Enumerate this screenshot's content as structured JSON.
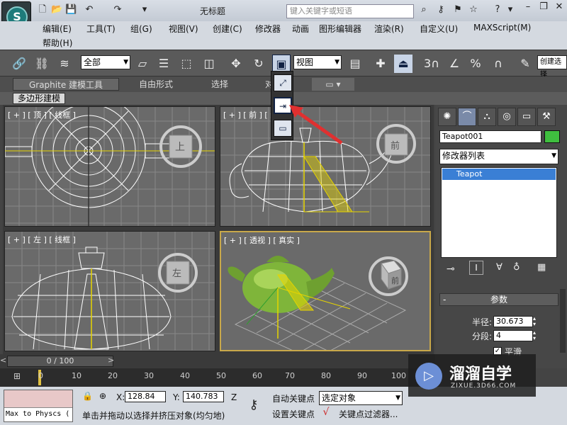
{
  "window": {
    "title": "无标题",
    "search_placeholder": "键入关键字或短语"
  },
  "menu": [
    "编辑(E)",
    "工具(T)",
    "组(G)",
    "视图(V)",
    "创建(C)",
    "修改器",
    "动画",
    "图形编辑器",
    "渲染(R)",
    "自定义(U)",
    "MAXScript(M)",
    "帮助(H)"
  ],
  "toolbar": {
    "selection_filter": "全部",
    "reference_coord": "视图",
    "named_selection": "创建选择"
  },
  "ribbon": {
    "tabs": [
      "Graphite 建模工具",
      "自由形式",
      "选择",
      "对"
    ],
    "sub_label": "多边形建模"
  },
  "viewports": {
    "top": {
      "label": "[ + ] [ 顶 ] [ 线框 ]",
      "cube_label": "上"
    },
    "front": {
      "label": "[ + ] [ 前 ] [ 线框 ]",
      "cube_label": "前"
    },
    "left": {
      "label": "[ + ] [ 左 ] [ 线框 ]",
      "cube_label": "左"
    },
    "perspective": {
      "label": "[ + ] [ 透视 ] [ 真实 ]",
      "cube_label": "前"
    }
  },
  "command_panel": {
    "object_name": "Teapot001",
    "object_color": "#3fbf3f",
    "modifier_list": "修改器列表",
    "stack_item": "Teapot",
    "params_title": "参数",
    "radius_label": "半径:",
    "radius_value": "30.673",
    "segments_label": "分段:",
    "segments_value": "4",
    "smooth_label": "平滑"
  },
  "timeline": {
    "slider": "0 / 100",
    "ticks": [
      "0",
      "10",
      "20",
      "30",
      "40",
      "50",
      "60",
      "70",
      "80",
      "90",
      "100"
    ]
  },
  "status": {
    "maxscript": "Max to Physcs (",
    "x_label": "X:",
    "x_value": "128.84",
    "y_label": "Y:",
    "y_value": "140.783",
    "z_label": "Z",
    "prompt": "单击并拖动以选择并挤压对象(均匀地)",
    "auto_key": "自动关键点",
    "set_key": "设置关键点",
    "key_target": "选定对象",
    "key_filters": "关键点过滤器..."
  },
  "watermark": {
    "title": "溜溜自学",
    "url": "ZIXUE.3D66.COM"
  }
}
